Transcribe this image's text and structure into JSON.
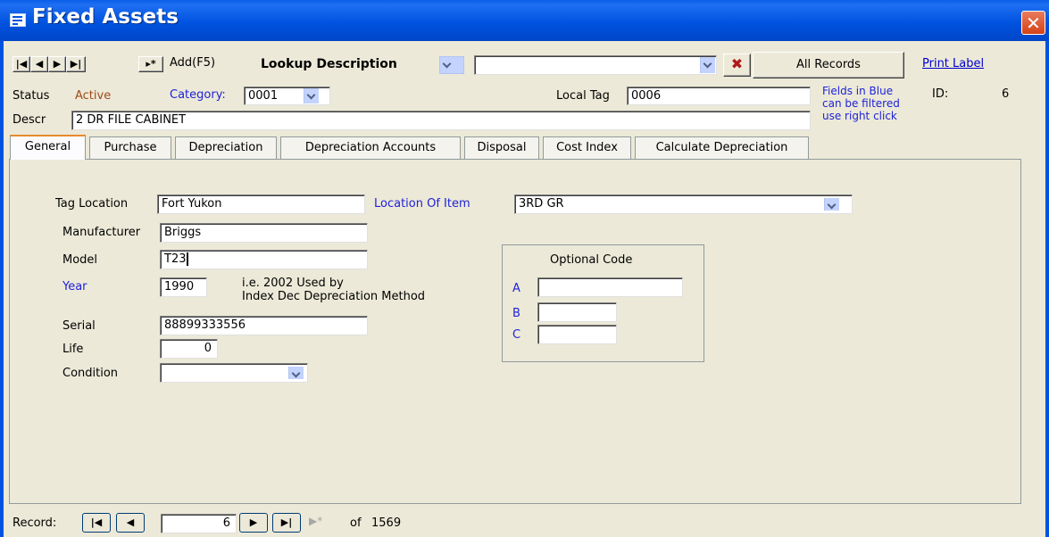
{
  "window": {
    "title": "Fixed Assets",
    "close_glyph": "✕"
  },
  "toolbar": {
    "nav_first": "|◀",
    "nav_prev": "◀",
    "nav_next": "▶",
    "nav_last": "▶|",
    "nav_new": "▸*",
    "add_label": "Add(F5)",
    "lookup_label": "Lookup Description",
    "lookup_value": "",
    "clear_filter_glyph": "✖",
    "all_records_label": "All Records",
    "print_label": "Print Label"
  },
  "header": {
    "status_label": "Status",
    "status_value": "Active",
    "category_label": "Category:",
    "category_value": "0001",
    "local_tag_label": "Local Tag",
    "local_tag_value": "0006",
    "hint_line1": "Fields in Blue",
    "hint_line2": "can be filtered",
    "hint_line3": "use right click",
    "id_label": "ID:",
    "id_value": "6",
    "descr_label": "Descr",
    "descr_value": "2 DR FILE CABINET"
  },
  "tabs": [
    "General",
    "Purchase",
    "Depreciation",
    "Depreciation Accounts",
    "Disposal",
    "Cost Index",
    "Calculate Depreciation"
  ],
  "general": {
    "tag_location_label": "Tag Location",
    "tag_location_value": "Fort Yukon",
    "location_of_item_label": "Location Of Item",
    "location_of_item_value": "3RD GR",
    "manufacturer_label": "Manufacturer",
    "manufacturer_value": "Briggs",
    "model_label": "Model",
    "model_value": "T23",
    "year_label": "Year",
    "year_value": "1990",
    "year_hint_line1": "i.e. 2002 Used by",
    "year_hint_line2": "Index Dec Depreciation Method",
    "serial_label": "Serial",
    "serial_value": "88899333556",
    "life_label": "Life",
    "life_value": "0",
    "condition_label": "Condition",
    "condition_value": "",
    "optional_code_title": "Optional Code",
    "optional_a_label": "A",
    "optional_a_value": "",
    "optional_b_label": "B",
    "optional_b_value": "",
    "optional_c_label": "C",
    "optional_c_value": ""
  },
  "record_nav": {
    "label": "Record:",
    "current": "6",
    "of_label": "of",
    "total": "1569",
    "first": "|◀",
    "prev": "◀",
    "next": "▶",
    "last": "▶|",
    "new": "▶*"
  }
}
